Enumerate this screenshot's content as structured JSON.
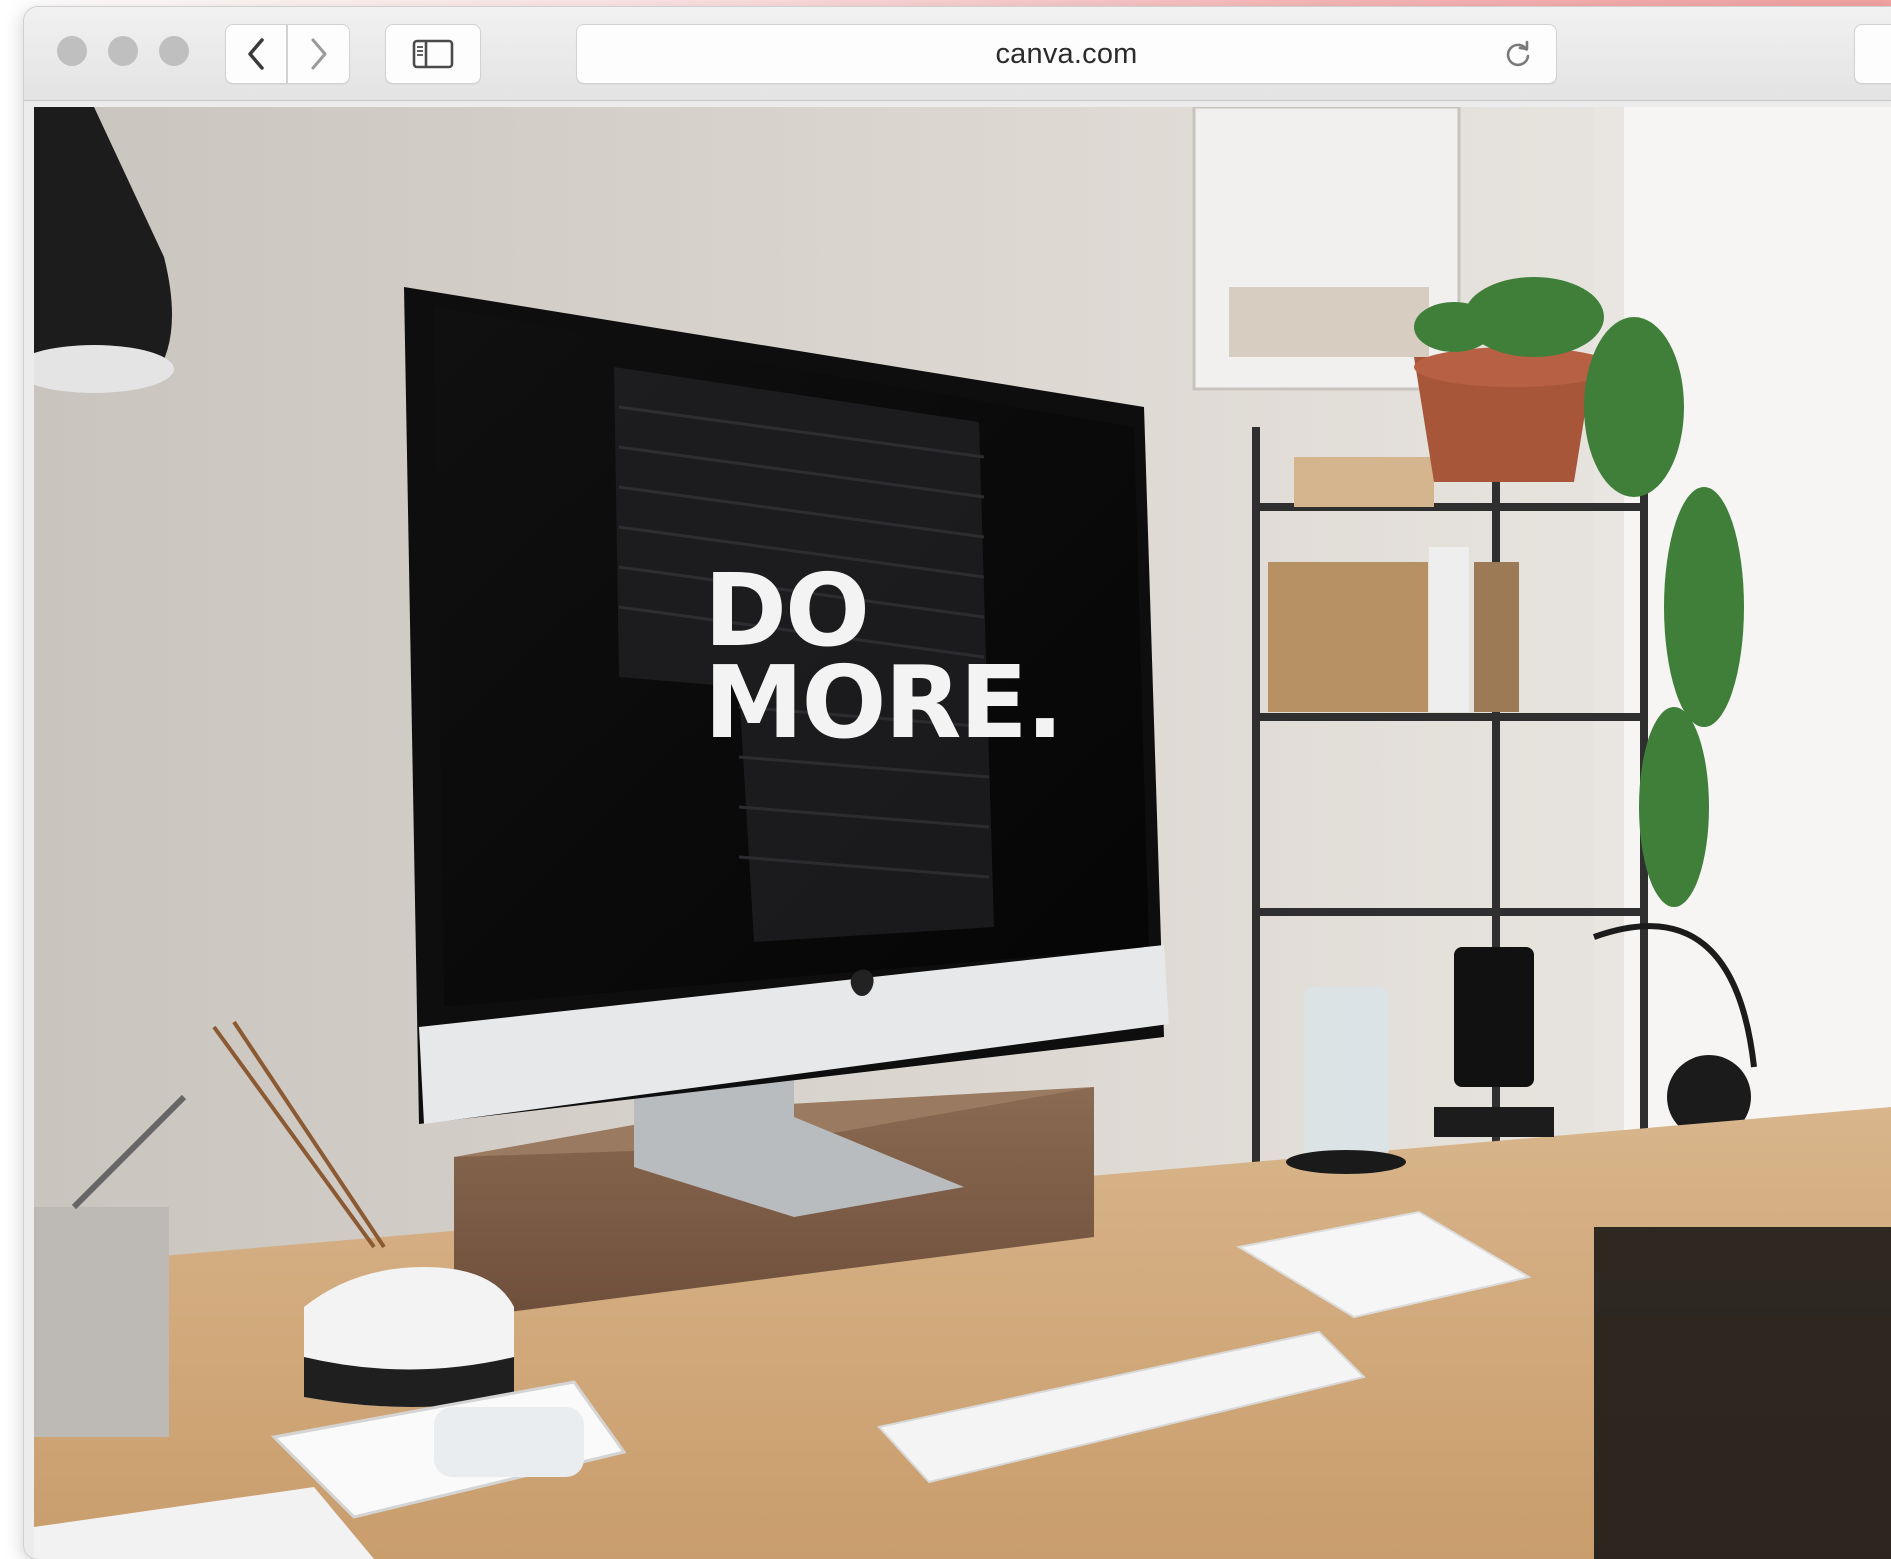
{
  "browser": {
    "address_bar": {
      "url": "canva.com"
    },
    "controls": {
      "back_icon": "chevron-left-icon",
      "forward_icon": "chevron-right-icon",
      "sidebar_icon": "sidebar-icon",
      "reload_icon": "reload-icon"
    }
  },
  "page": {
    "screen_text": {
      "line1": "DO",
      "line2": "MORE."
    }
  },
  "colors": {
    "accent_gradient": "#f2a3a3",
    "toolbar": "#e8e8e8",
    "traffic_light": "#bfbfbf"
  }
}
